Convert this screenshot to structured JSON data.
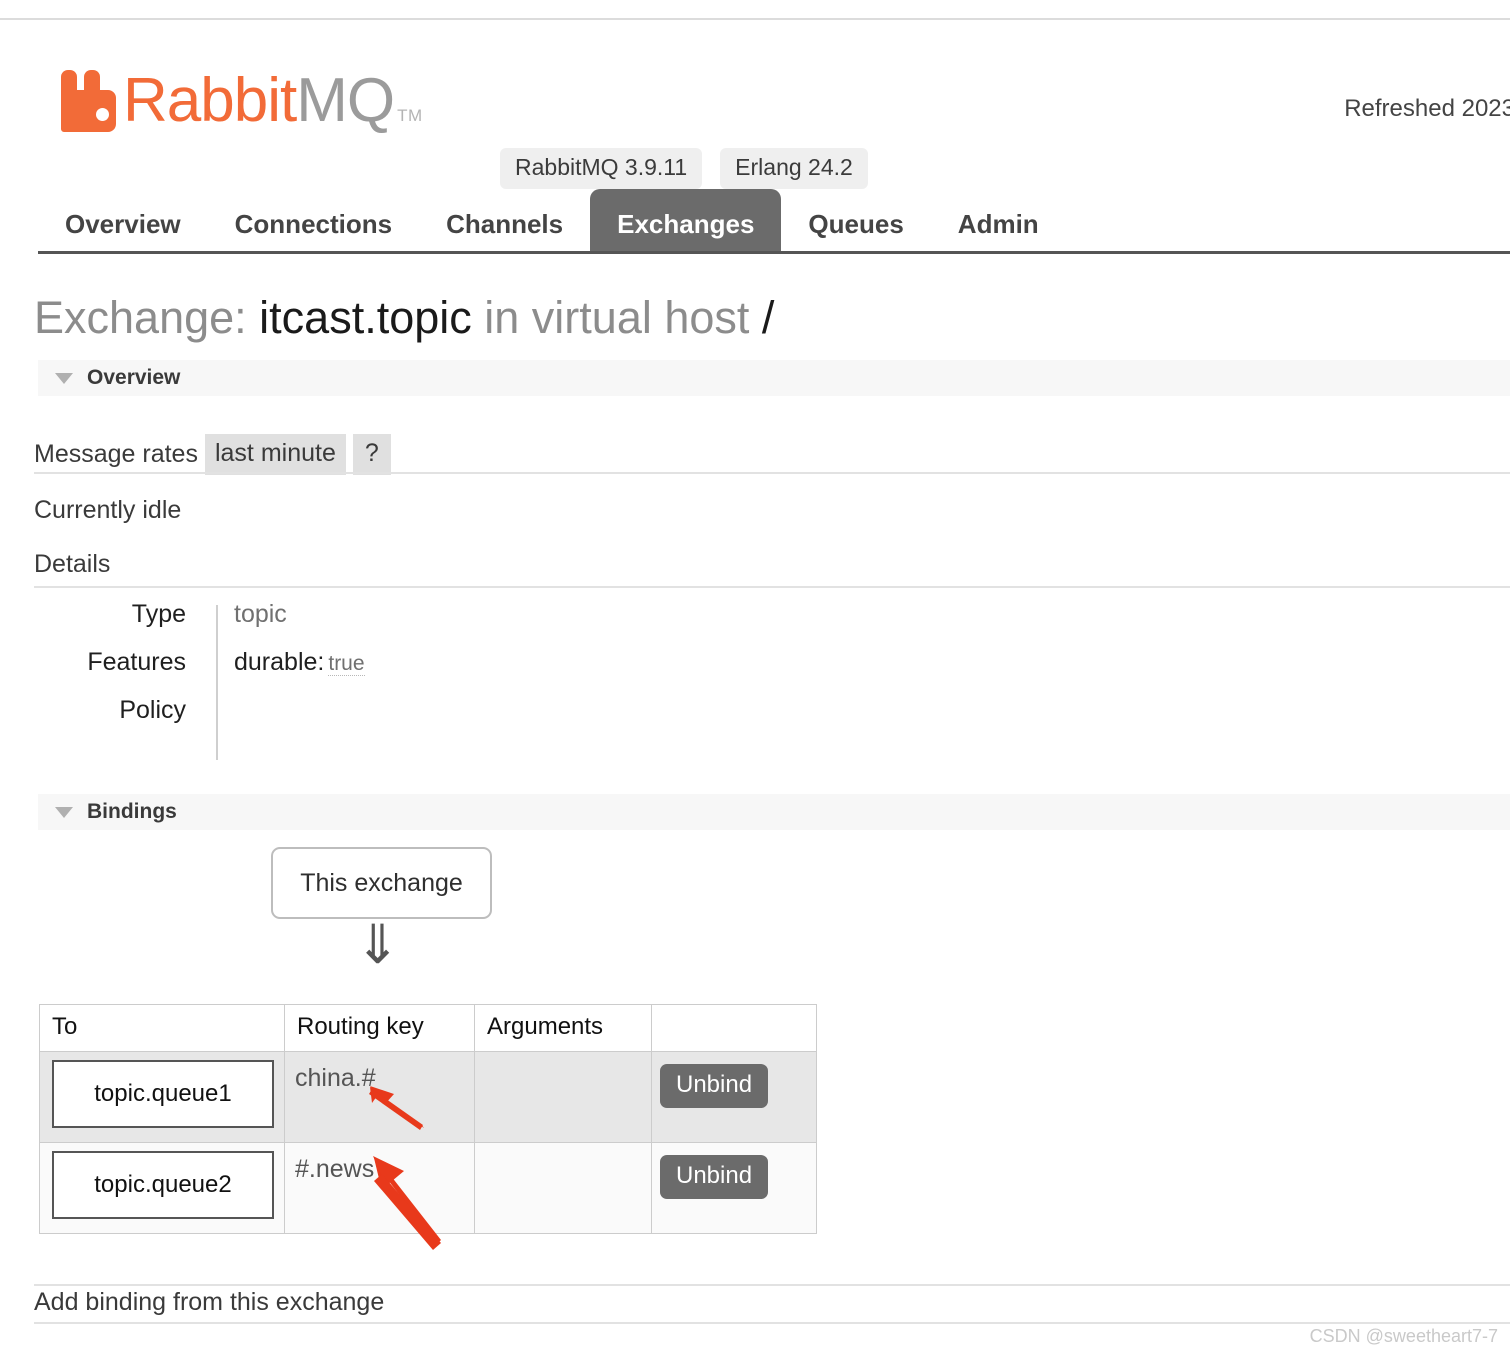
{
  "header": {
    "logo_text_orange": "Rabbit",
    "logo_text_grey": "MQ",
    "logo_tm": "TM",
    "badges": [
      {
        "label": "RabbitMQ 3.9.11"
      },
      {
        "label": "Erlang 24.2"
      }
    ],
    "refreshed": "Refreshed 2023"
  },
  "nav": {
    "items": [
      {
        "label": "Overview",
        "active": false
      },
      {
        "label": "Connections",
        "active": false
      },
      {
        "label": "Channels",
        "active": false
      },
      {
        "label": "Exchanges",
        "active": true
      },
      {
        "label": "Queues",
        "active": false
      },
      {
        "label": "Admin",
        "active": false
      }
    ]
  },
  "page": {
    "title_prefix": "Exchange:",
    "title_name": "itcast.topic",
    "title_middle": "in virtual host",
    "title_vhost": "/"
  },
  "overview": {
    "section_label": "Overview",
    "rates_label": "Message rates",
    "rates_period": "last minute",
    "rates_help": "?",
    "idle_text": "Currently idle",
    "details_label": "Details",
    "rows": [
      {
        "key": "Type",
        "value": "topic"
      },
      {
        "key": "Features",
        "value": "durable:",
        "value_extra": "true"
      },
      {
        "key": "Policy",
        "value": ""
      }
    ]
  },
  "bindings": {
    "section_label": "Bindings",
    "source_box": "This exchange",
    "arrow_glyph": "⇓",
    "columns": [
      "To",
      "Routing key",
      "Arguments",
      ""
    ],
    "rows": [
      {
        "to": "topic.queue1",
        "routing_key": "china.#",
        "arguments": "",
        "action": "Unbind"
      },
      {
        "to": "topic.queue2",
        "routing_key": "#.news",
        "arguments": "",
        "action": "Unbind"
      }
    ],
    "add_binding_label": "Add binding from this exchange"
  },
  "annotations": {
    "arrow_color": "#e8391b",
    "count": 2
  },
  "watermark": {
    "text": "CSDN @sweetheart7-7"
  }
}
